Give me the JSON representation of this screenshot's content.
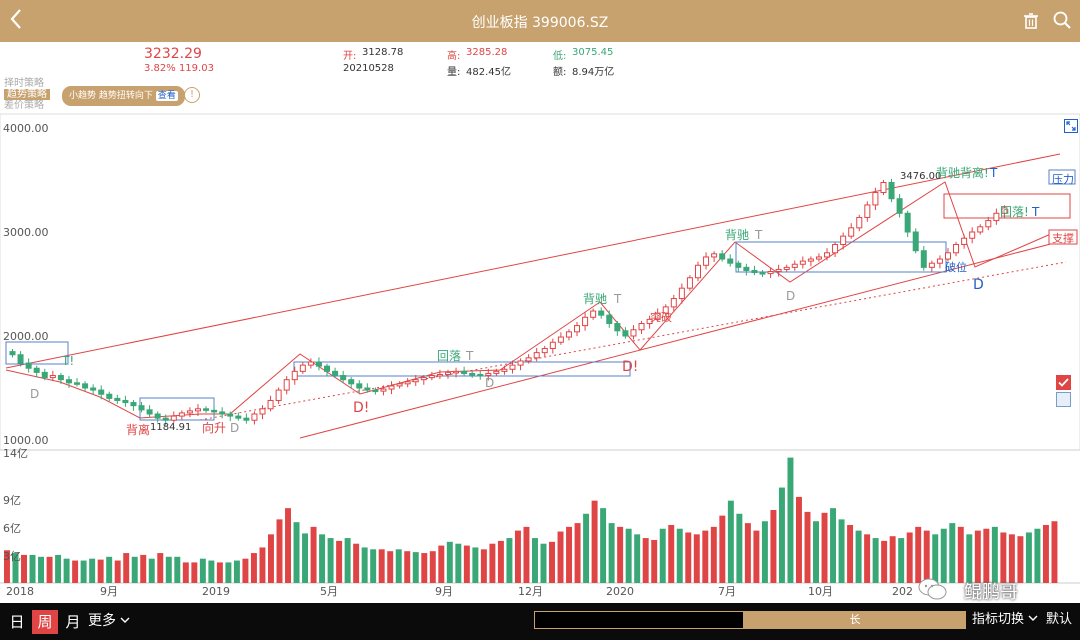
{
  "header": {
    "title": "创业板指 399006.SZ"
  },
  "quote": {
    "price": "3232.29",
    "change": "3.82% 119.03",
    "open_label": "开:",
    "open": "3128.78",
    "high_label": "高:",
    "high": "3285.28",
    "low_label": "低:",
    "low": "3075.45",
    "date": "20210528",
    "volume_label": "量:",
    "volume": "482.45亿",
    "amount_label": "额:",
    "amount": "8.94万亿"
  },
  "strategies": {
    "items": [
      "择时策略",
      "趋势策略",
      "差价策略"
    ],
    "active": "趋势策略"
  },
  "trend_pill": {
    "text": "小趋势 趋势扭转向下",
    "link": "查看"
  },
  "info_glyph": "!",
  "colors": {
    "up": "#e04545",
    "down": "#3aa776",
    "gold": "#c8a26e",
    "bg": "#ffffff"
  },
  "chart_data": [
    {
      "type": "candlestick",
      "yticks": [
        "4000.00",
        "3000.00",
        "2000.00",
        "1000.00"
      ],
      "ylim": [
        1000,
        4000
      ],
      "xticks": [
        "2018",
        "9月",
        "2019",
        "5月",
        "9月",
        "12月",
        "2020",
        "7月",
        "10月",
        "2021"
      ],
      "closes": [
        1820,
        1740,
        1690,
        1650,
        1600,
        1620,
        1580,
        1550,
        1540,
        1500,
        1480,
        1440,
        1400,
        1380,
        1360,
        1330,
        1290,
        1250,
        1210,
        1190,
        1230,
        1260,
        1280,
        1300,
        1285,
        1270,
        1250,
        1230,
        1210,
        1190,
        1250,
        1300,
        1380,
        1480,
        1580,
        1660,
        1720,
        1750,
        1710,
        1660,
        1620,
        1580,
        1540,
        1500,
        1480,
        1470,
        1490,
        1520,
        1540,
        1560,
        1580,
        1600,
        1620,
        1630,
        1650,
        1660,
        1640,
        1630,
        1620,
        1640,
        1660,
        1680,
        1720,
        1760,
        1790,
        1840,
        1880,
        1940,
        1990,
        2040,
        2100,
        2180,
        2240,
        2200,
        2120,
        2050,
        2000,
        2060,
        2120,
        2160,
        2220,
        2280,
        2360,
        2460,
        2560,
        2680,
        2760,
        2790,
        2740,
        2700,
        2660,
        2630,
        2610,
        2600,
        2620,
        2640,
        2660,
        2690,
        2720,
        2740,
        2760,
        2800,
        2880,
        2960,
        3040,
        3140,
        3260,
        3380,
        3476,
        3320,
        3180,
        3000,
        2820,
        2660,
        2700,
        2740,
        2800,
        2880,
        2940,
        3000,
        3050,
        3110,
        3180,
        3232
      ],
      "annotations": [
        "背离",
        "1184.91",
        "向升",
        "D",
        "D!",
        "回落",
        "T",
        "D",
        "背驰",
        "T",
        "突破",
        "D!",
        "背驰",
        "T",
        "D",
        "破位",
        "D",
        "3476.00",
        "背驰背离!",
        "T",
        "回落!",
        "T",
        "压力",
        "支撑",
        "T!",
        "D"
      ]
    },
    {
      "type": "bar",
      "yticks": [
        "14亿",
        "9亿",
        "6亿",
        "3亿"
      ],
      "ylim": [
        0,
        14
      ],
      "values": [
        3.5,
        3.2,
        3,
        3,
        2.8,
        2.8,
        3,
        2.6,
        2.4,
        2.4,
        2.6,
        2.5,
        2.8,
        2.4,
        3.2,
        2.8,
        3,
        2.6,
        3.2,
        2.8,
        2.8,
        2.2,
        2.2,
        2.6,
        2.4,
        2.2,
        2.2,
        2.4,
        2.6,
        3.2,
        3.8,
        5.2,
        6.8,
        8,
        6.5,
        5.3,
        6,
        5.2,
        4.8,
        4.5,
        4.8,
        4.2,
        3.8,
        3.6,
        3.6,
        3.4,
        3.6,
        3.4,
        3.3,
        3.2,
        3.4,
        4,
        4.4,
        4.2,
        4,
        3.8,
        3.6,
        4.2,
        4.5,
        4.8,
        5.6,
        6,
        4.8,
        4.2,
        4.4,
        5.5,
        6,
        6.4,
        7.4,
        8.8,
        8,
        6.4,
        6,
        5.8,
        5.2,
        4.8,
        4.6,
        5.8,
        6.2,
        5.8,
        5.4,
        5.2,
        5.6,
        6,
        7.2,
        8.8,
        7.4,
        6.4,
        5.6,
        6.6,
        7.8,
        10.2,
        13.4,
        9.2,
        7.6,
        6.6,
        7.5,
        8,
        6.8,
        6.2,
        5.6,
        5.2,
        4.8,
        4.5,
        5,
        4.8,
        5.4,
        6,
        5.6,
        5.2,
        5.8,
        6.4,
        6,
        5.2,
        5.6,
        5.8,
        6,
        5.4,
        5.2,
        5,
        5.4,
        5.8,
        6.2,
        6.6
      ],
      "bar_up": [
        1,
        0,
        1,
        0,
        0,
        1,
        0,
        0,
        1,
        0,
        0,
        1,
        0,
        1,
        1,
        0,
        1,
        0,
        1,
        0,
        0,
        1,
        1,
        0,
        0,
        1,
        0,
        0,
        1,
        1,
        1,
        1,
        1,
        1,
        0,
        0,
        1,
        0,
        0,
        1,
        0,
        1,
        0,
        0,
        1,
        1,
        0,
        1,
        0,
        1,
        1,
        1,
        0,
        0,
        1,
        0,
        1,
        1,
        1,
        0,
        1,
        1,
        0,
        0,
        1,
        1,
        1,
        1,
        0,
        1,
        0,
        0,
        1,
        0,
        0,
        1,
        1,
        0,
        1,
        0,
        1,
        1,
        1,
        1,
        1,
        0,
        0,
        1,
        1,
        0,
        1,
        0,
        0,
        1,
        1,
        0,
        1,
        0,
        0,
        1,
        0,
        1,
        0,
        1,
        1,
        0,
        1,
        1,
        1,
        0,
        0,
        0,
        1,
        0,
        1,
        1,
        0,
        1,
        1,
        1,
        0,
        0,
        1,
        1
      ],
      "xticks": [
        "2018",
        "9月",
        "2019",
        "5月",
        "9月",
        "12月",
        "2020",
        "7月",
        "10月",
        "202"
      ]
    }
  ],
  "watermark": "鲲鹏哥",
  "bottom": {
    "periods": [
      "日",
      "周",
      "月"
    ],
    "active": "周",
    "more": "更多",
    "chevron": "chevron-down-icon",
    "range_thumb": "长",
    "indicator_switch": "指标切换",
    "default": "默认",
    "dropdown_arrow": "arrow-down-icon"
  }
}
